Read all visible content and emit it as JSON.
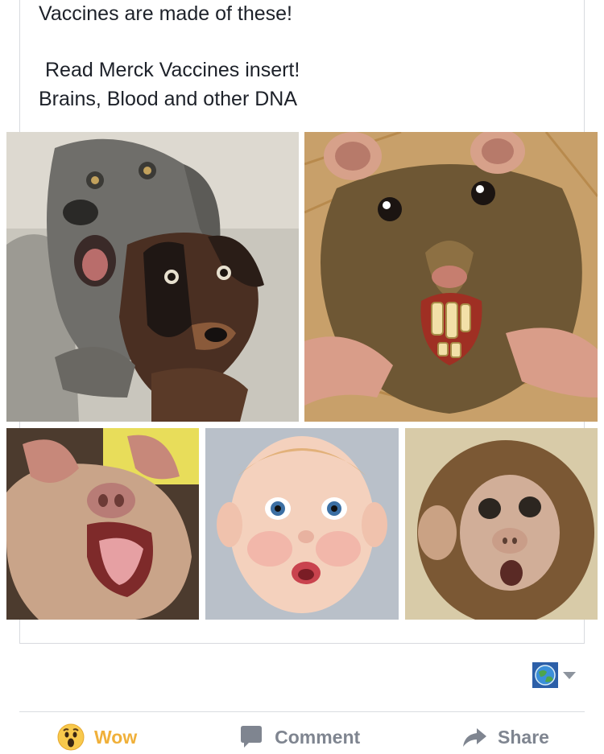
{
  "post": {
    "lines": [
      "Vaccines are made of these!",
      "Read Merck Vaccines insert!",
      "Brains, Blood and other DNA"
    ]
  },
  "photos": [
    {
      "subject": "dogs",
      "description_icon": "dog-photo"
    },
    {
      "subject": "rat",
      "description_icon": "rat-photo"
    },
    {
      "subject": "pig",
      "description_icon": "pig-photo"
    },
    {
      "subject": "baby",
      "description_icon": "baby-photo"
    },
    {
      "subject": "monkey",
      "description_icon": "monkey-photo"
    }
  ],
  "audience": {
    "icon": "globe-icon",
    "dropdown_icon": "chevron-down-icon"
  },
  "actions": {
    "wow_label": "Wow",
    "comment_label": "Comment",
    "share_label": "Share",
    "wow_color": "#f0b03a",
    "action_color": "#7f8590"
  }
}
